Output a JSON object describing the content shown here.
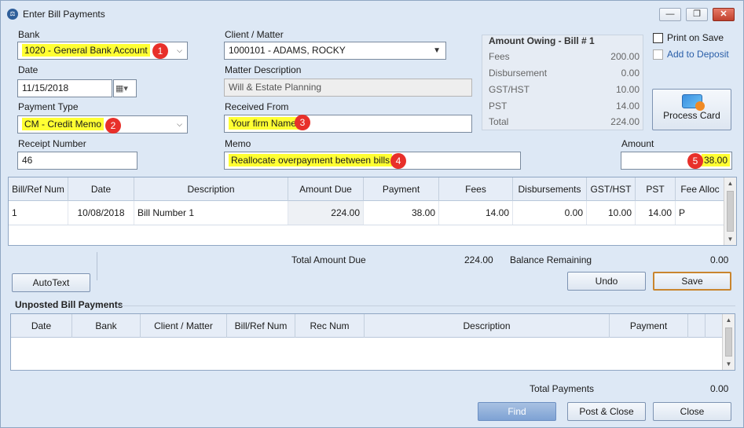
{
  "window": {
    "title": "Enter Bill Payments",
    "minimize": "—",
    "maximize": "❐",
    "close": "✕"
  },
  "form": {
    "bank_label": "Bank",
    "bank_value": "1020 - General Bank Account",
    "date_label": "Date",
    "date_value": "11/15/2018",
    "payment_type_label": "Payment Type",
    "payment_type_value": "CM - Credit Memo",
    "receipt_label": "Receipt Number",
    "receipt_value": "46",
    "client_label": "Client / Matter",
    "client_value": "1000101 - ADAMS, ROCKY",
    "matter_desc_label": "Matter Description",
    "matter_desc_value": "Will & Estate Planning",
    "received_from_label": "Received From",
    "received_from_value": "Your firm Name",
    "memo_label": "Memo",
    "memo_value": "Reallocate overpayment between bills",
    "amount_label": "Amount",
    "amount_value": "38.00"
  },
  "badges": [
    "1",
    "2",
    "3",
    "4",
    "5"
  ],
  "owing": {
    "title": "Amount Owing - Bill # 1",
    "rows": [
      {
        "label": "Fees",
        "value": "200.00"
      },
      {
        "label": "Disbursement",
        "value": "0.00"
      },
      {
        "label": "GST/HST",
        "value": "10.00"
      },
      {
        "label": "PST",
        "value": "14.00"
      },
      {
        "label": "Total",
        "value": "224.00"
      }
    ]
  },
  "options": {
    "print_on_save": "Print on Save",
    "add_to_deposit": "Add to Deposit",
    "process_card": "Process Card"
  },
  "bills_table": {
    "columns": [
      "Bill/Ref Num",
      "Date",
      "Description",
      "Amount Due",
      "Payment",
      "Fees",
      "Disbursements",
      "GST/HST",
      "PST",
      "Fee Alloc"
    ],
    "rows": [
      [
        "1",
        "10/08/2018",
        "Bill Number 1",
        "224.00",
        "38.00",
        "14.00",
        "0.00",
        "10.00",
        "14.00",
        "P"
      ]
    ]
  },
  "totals": {
    "total_due_label": "Total Amount Due",
    "total_due_value": "224.00",
    "balance_label": "Balance Remaining",
    "balance_value": "0.00"
  },
  "buttons": {
    "autotext": "AutoText",
    "undo": "Undo",
    "save": "Save",
    "find": "Find",
    "post_close": "Post & Close",
    "close": "Close"
  },
  "unposted": {
    "label": "Unposted Bill Payments",
    "columns": [
      "Date",
      "Bank",
      "Client / Matter",
      "Bill/Ref Num",
      "Rec Num",
      "Description",
      "Payment"
    ],
    "total_label": "Total Payments",
    "total_value": "0.00"
  },
  "colors": {
    "highlight": "#ffff33",
    "badge": "#e8302a",
    "window_bg": "#dde8f5"
  }
}
